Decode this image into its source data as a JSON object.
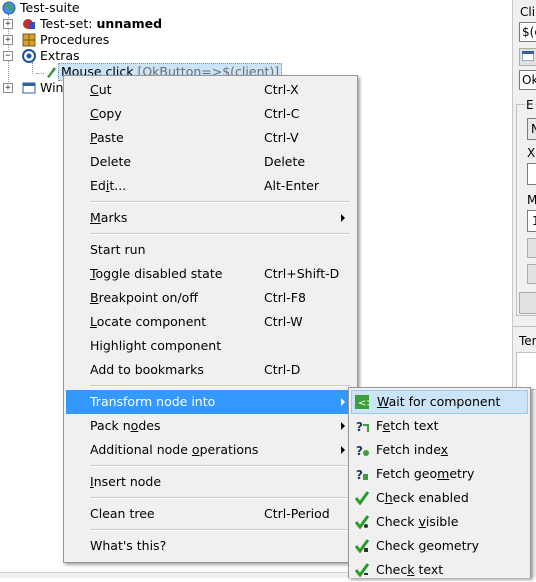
{
  "tree": {
    "root": "Test-suite",
    "testset_prefix": "Test-set:",
    "testset_name": "unnamed",
    "procedures": "Procedures",
    "extras": "Extras",
    "mouse_click": "Mouse click",
    "mouse_click_param": "[OkButton=>$(client)]",
    "windows_partial": "Win"
  },
  "right_panel": {
    "label1": "Cli",
    "field1_value": "$(c",
    "field2_value": "Ok",
    "label_e": "E",
    "field_n": "N",
    "label_x": "X",
    "label_m": "M",
    "field_one": "1",
    "label_ter": "Ter"
  },
  "context_menu": {
    "items": [
      {
        "pre": "",
        "u": "C",
        "post": "ut",
        "shortcut": "Ctrl-X"
      },
      {
        "pre": "",
        "u": "C",
        "post": "opy",
        "shortcut": "Ctrl-C"
      },
      {
        "pre": "",
        "u": "P",
        "post": "aste",
        "shortcut": "Ctrl-V"
      },
      {
        "pre": "Delete",
        "u": "",
        "post": "",
        "shortcut": "Delete"
      },
      {
        "pre": "Ed",
        "u": "i",
        "post": "t...",
        "shortcut": "Alt-Enter"
      },
      {
        "pre": "",
        "u": "M",
        "post": "arks",
        "shortcut": ""
      },
      {
        "pre": "Start run",
        "u": "",
        "post": "",
        "shortcut": ""
      },
      {
        "pre": "",
        "u": "T",
        "post": "oggle disabled state",
        "shortcut": "Ctrl+Shift-D"
      },
      {
        "pre": "",
        "u": "B",
        "post": "reakpoint on/off",
        "shortcut": "Ctrl-F8"
      },
      {
        "pre": "",
        "u": "L",
        "post": "ocate component",
        "shortcut": "Ctrl-W"
      },
      {
        "pre": "Highlight component",
        "u": "",
        "post": "",
        "shortcut": ""
      },
      {
        "pre": "Add to bookmarks",
        "u": "",
        "post": "",
        "shortcut": "Ctrl-D"
      },
      {
        "pre": "Transform node into",
        "u": "",
        "post": "",
        "shortcut": ""
      },
      {
        "pre": "Pack n",
        "u": "o",
        "post": "des",
        "shortcut": ""
      },
      {
        "pre": "Additional node ",
        "u": "o",
        "post": "perations",
        "shortcut": ""
      },
      {
        "pre": "",
        "u": "I",
        "post": "nsert node",
        "shortcut": ""
      },
      {
        "pre": "Clean tree",
        "u": "",
        "post": "",
        "shortcut": "Ctrl-Period"
      },
      {
        "pre": "What's this?",
        "u": "",
        "post": "",
        "shortcut": ""
      }
    ]
  },
  "submenu": {
    "items": [
      {
        "pre": "",
        "u": "W",
        "post": "ait for component",
        "icon": "wait-icon"
      },
      {
        "pre": "F",
        "u": "e",
        "post": "tch text",
        "icon": "fetch-text-icon"
      },
      {
        "pre": "Fetch inde",
        "u": "x",
        "post": "",
        "icon": "fetch-index-icon"
      },
      {
        "pre": "Fetch geo",
        "u": "m",
        "post": "etry",
        "icon": "fetch-geometry-icon"
      },
      {
        "pre": "C",
        "u": "h",
        "post": "eck enabled",
        "icon": "check-enabled-icon"
      },
      {
        "pre": "Check ",
        "u": "v",
        "post": "isible",
        "icon": "check-visible-icon"
      },
      {
        "pre": "Check ",
        "u": "g",
        "post": "eometry",
        "icon": "check-geometry-icon"
      },
      {
        "pre": "Chec",
        "u": "k",
        "post": " text",
        "icon": "check-text-icon"
      }
    ]
  },
  "colors": {
    "highlight": "#3399ff",
    "menu_bg": "#f0f0f0",
    "submenu_highlight": "#cce4f7"
  }
}
